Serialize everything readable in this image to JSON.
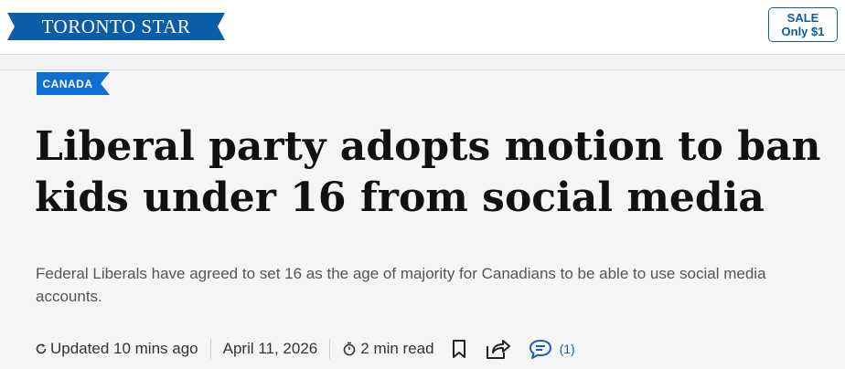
{
  "header": {
    "logo_text": "TORONTO STAR",
    "sale_line1": "SALE",
    "sale_line2": "Only $1"
  },
  "article": {
    "category": "CANADA",
    "headline": "Liberal party adopts motion to ban kids under 16 from social media",
    "subheadline": "Federal Liberals have agreed to set 16 as the age of majority for Canadians to be able to use social media accounts.",
    "updated": "Updated 10 mins ago",
    "date": "April 11, 2026",
    "read_time": "2 min read",
    "comment_count": "(1)"
  },
  "colors": {
    "brand_blue": "#0a5ea8",
    "category_blue": "#0f6fd4"
  },
  "icons": [
    "refresh-icon",
    "timer-icon",
    "bookmark-icon",
    "share-icon",
    "comment-icon"
  ]
}
